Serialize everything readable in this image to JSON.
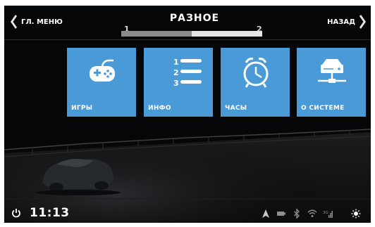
{
  "header": {
    "title": "РАЗНОЕ",
    "back_left_label": "ГЛ. МЕНЮ",
    "back_right_label": "НАЗАД",
    "pager": {
      "pages": [
        "1",
        "2"
      ],
      "current": 1
    }
  },
  "tiles": [
    {
      "label": "ИГРЫ",
      "icon": "gamepad-icon"
    },
    {
      "label": "ИНФО",
      "icon": "numbered-list-icon",
      "list_numbers": [
        "1",
        "2",
        "3"
      ]
    },
    {
      "label": "ЧАСЫ",
      "icon": "alarm-clock-icon"
    },
    {
      "label": "О СИСТЕМЕ",
      "icon": "hard-drive-network-icon"
    }
  ],
  "status": {
    "time": "11:13",
    "icons": [
      "power-icon",
      "navigation-arrow-icon",
      "battery-icon",
      "bluetooth-icon",
      "wifi-icon",
      "3g-signal-icon",
      "brightness-icon"
    ],
    "signal_label": "3G"
  },
  "colors": {
    "tile": "#4a9ad8",
    "background": "#050607",
    "accent_bar": "#e6e6e6"
  }
}
